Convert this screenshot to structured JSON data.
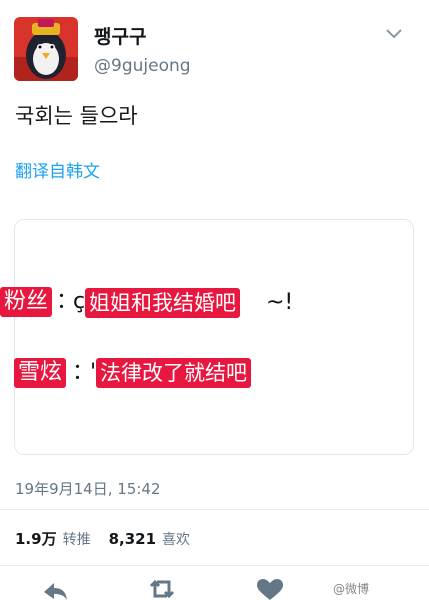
{
  "user": {
    "display_name": "팽구구",
    "handle": "@9gujeong"
  },
  "tweet": {
    "text": "국회는 들으라",
    "translate_label": "翻译自韩文"
  },
  "card": {
    "line1": {
      "speaker": "粉丝",
      "colon": "：",
      "stray": "ç",
      "highlight": "姐姐和我结婚吧",
      "suffix": "~!"
    },
    "line2": {
      "speaker": "雪炫",
      "colon": "：",
      "stray": "'",
      "highlight": "法律改了就结吧"
    }
  },
  "meta": {
    "timestamp": "19年9月14日, 15:42"
  },
  "stats": {
    "retweets_value": "1.9万",
    "retweets_label": "转推",
    "likes_value": "8,321",
    "likes_label": "喜欢"
  },
  "watermark": "@微博"
}
